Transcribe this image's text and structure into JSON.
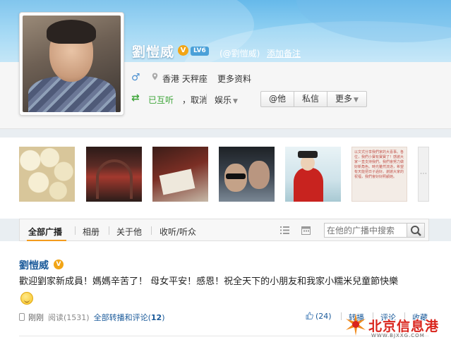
{
  "profile": {
    "name": "劉愷威",
    "verify_mark": "V",
    "level": "LV6",
    "handle": "(@劉愷威)",
    "add_remark": "添加备注",
    "location": "香港 天秤座",
    "more_info": "更多资料",
    "follow_status": "已互听",
    "unfollow": "，取消",
    "group": "娱乐",
    "buttons": [
      "@他",
      "私信",
      "更多"
    ]
  },
  "album": {
    "more": "⋯",
    "note_text": "以文式分享我們家的大喜事。各位，我們小寶有寶寶了！感謝大家一直支持我們。我們會努力做好新角色。時光雖然流逝，希望有天能把日子過好。謝謝大家的祝福，我們會好好照顧她。"
  },
  "tabs": {
    "items": [
      "全部广播",
      "相册",
      "关于他",
      "收听/听众"
    ],
    "search_placeholder": "在他的广播中搜索"
  },
  "post": {
    "author": "劉愷威",
    "verify_mark": "V",
    "text": "歡迎劉家新成員！媽媽辛苦了！ 母女平安！感恩！祝全天下的小朋友和我家小糯米兒童節快樂",
    "time": "刚刚",
    "reads": "阅读(1531)",
    "forward_comment": "全部转播和评论(",
    "forward_count": "12",
    "forward_close": ")",
    "likes": "(24)",
    "actions": [
      "转播",
      "评论",
      "收藏"
    ]
  },
  "watermark": {
    "text": "北京信息港",
    "url": "WWW.BJXXG.COM"
  },
  "colors": {
    "link": "#1a5a9a",
    "follow_green": "#3fa63a",
    "tab_accent": "#f39b1d",
    "verify_orange": "#f2a516",
    "watermark_red": "#d9251d"
  },
  "icons": [
    "male-icon",
    "location-pin-icon",
    "mutual-follow-icon",
    "list-view-icon",
    "calendar-icon",
    "search-icon",
    "phone-icon",
    "thumbs-up-icon",
    "smile-emoji-icon"
  ]
}
